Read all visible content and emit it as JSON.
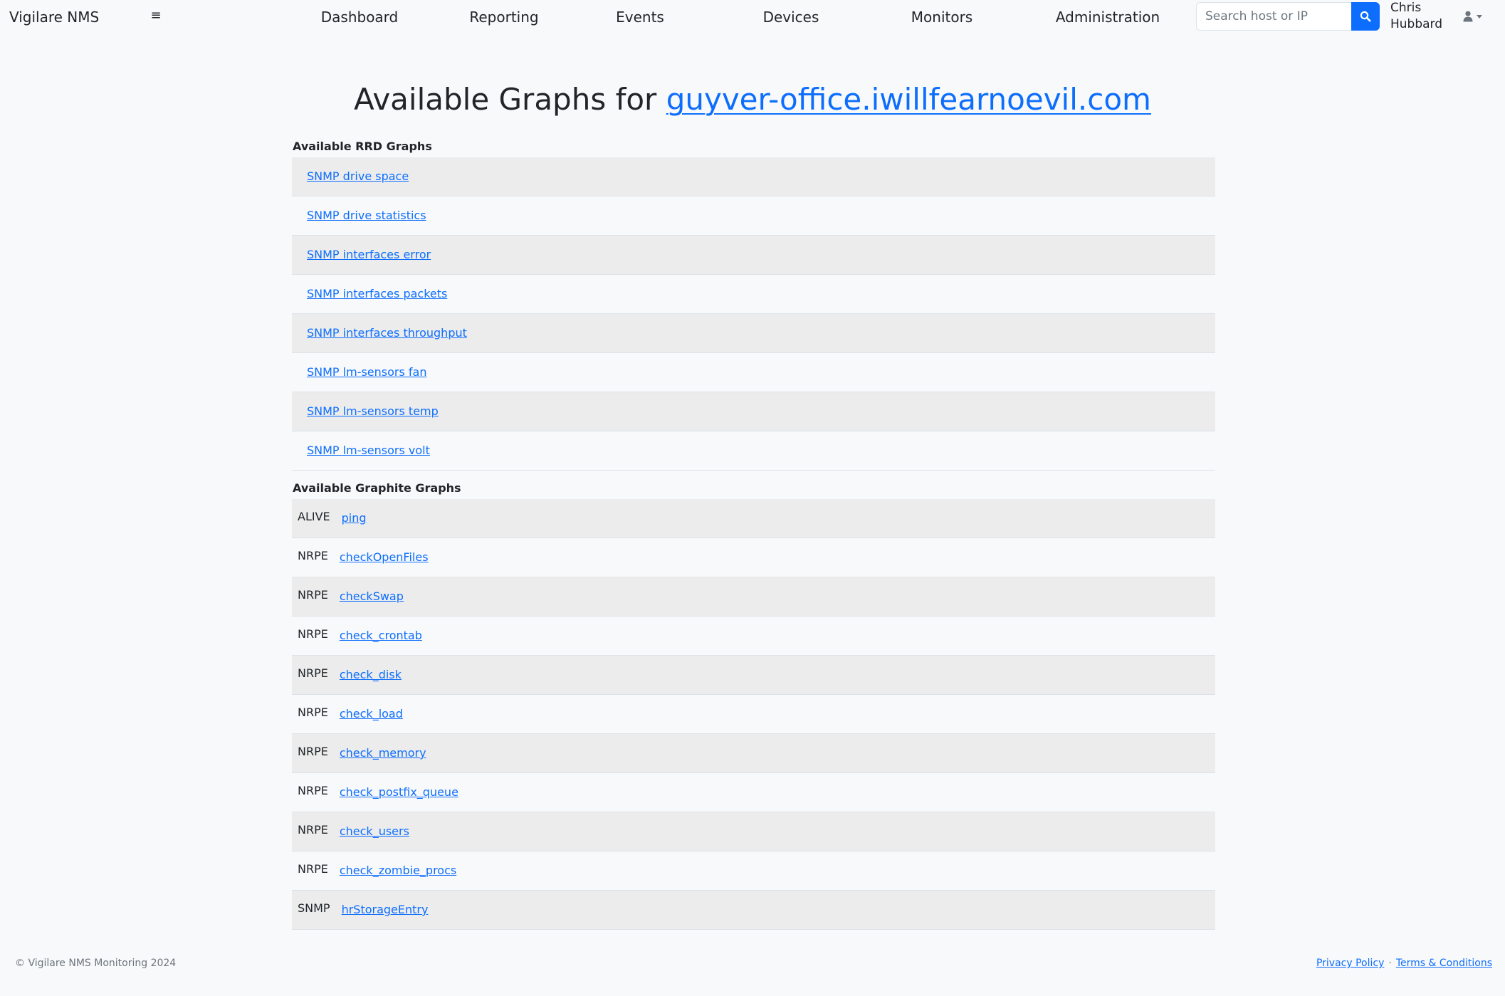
{
  "navbar": {
    "brand": "Vigilare NMS",
    "menu_toggle_glyph": "≡",
    "links": [
      "Dashboard",
      "Reporting",
      "Events",
      "Devices",
      "Monitors",
      "Administration"
    ],
    "search": {
      "placeholder": "Search host or IP",
      "value": "",
      "button_icon": "search-icon"
    },
    "user": {
      "name": "Chris Hubbard",
      "icon": "user-icon",
      "dropdown": "caret-down-icon"
    }
  },
  "title": {
    "prefix": "Available Graphs for",
    "host": "guyver-office.iwillfearnoevil.com"
  },
  "rrd": {
    "heading": "Available RRD Graphs",
    "items": [
      "SNMP drive space",
      "SNMP drive statistics",
      "SNMP interfaces error",
      "SNMP interfaces packets",
      "SNMP interfaces throughput",
      "SNMP lm-sensors fan",
      "SNMP lm-sensors temp",
      "SNMP lm-sensors volt"
    ]
  },
  "graphite": {
    "heading": "Available Graphite Graphs",
    "items": [
      {
        "type": "ALIVE",
        "name": "ping"
      },
      {
        "type": "NRPE",
        "name": "checkOpenFiles"
      },
      {
        "type": "NRPE",
        "name": "checkSwap"
      },
      {
        "type": "NRPE",
        "name": "check_crontab"
      },
      {
        "type": "NRPE",
        "name": "check_disk"
      },
      {
        "type": "NRPE",
        "name": "check_load"
      },
      {
        "type": "NRPE",
        "name": "check_memory"
      },
      {
        "type": "NRPE",
        "name": "check_postfix_queue"
      },
      {
        "type": "NRPE",
        "name": "check_users"
      },
      {
        "type": "NRPE",
        "name": "check_zombie_procs"
      },
      {
        "type": "SNMP",
        "name": "hrStorageEntry"
      }
    ]
  },
  "footer": {
    "copyright": "© Vigilare NMS Monitoring 2024",
    "privacy": "Privacy Policy",
    "separator": "·",
    "terms": "Terms & Conditions"
  },
  "colors": {
    "accent": "#0d6efd",
    "background": "#f8f9fa",
    "row_stripe": "#ececed",
    "text": "#212529",
    "muted": "#6c757d"
  }
}
